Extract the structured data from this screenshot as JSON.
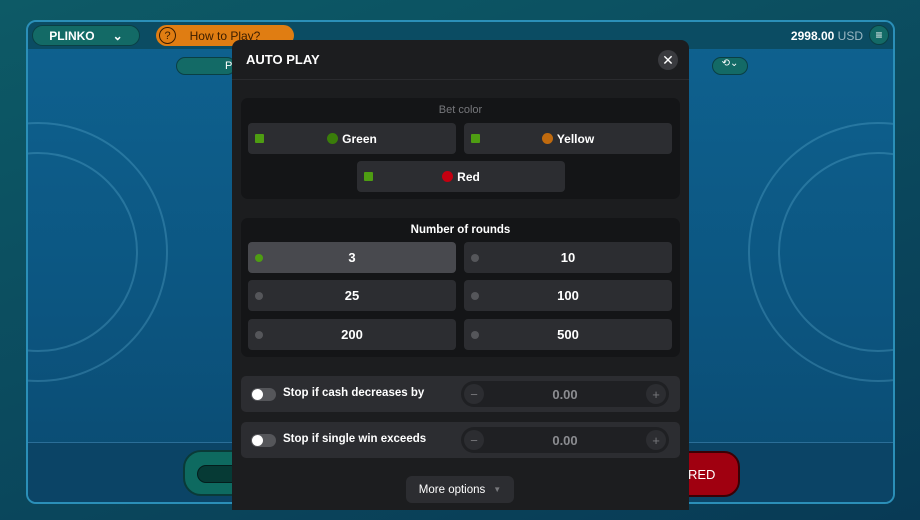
{
  "header": {
    "game": "PLINKO",
    "how_to_play": "How to Play?",
    "balance": "2998.00",
    "currency": "USD",
    "sub_pill": "P"
  },
  "bottom": {
    "red_button": "RED"
  },
  "modal": {
    "title": "AUTO PLAY",
    "bet_color": {
      "title": "Bet color",
      "options": [
        {
          "label": "Green",
          "color": "#3a7d0a",
          "checked": true
        },
        {
          "label": "Yellow",
          "color": "#c06a0e",
          "checked": true
        },
        {
          "label": "Red",
          "color": "#c40010",
          "checked": true
        }
      ]
    },
    "rounds": {
      "title": "Number of rounds",
      "options": [
        "3",
        "10",
        "25",
        "100",
        "200",
        "500"
      ],
      "selected": "3"
    },
    "stop_cash": {
      "label": "Stop if cash decreases by",
      "value": "0.00",
      "enabled": false
    },
    "stop_win": {
      "label": "Stop if single win exceeds",
      "value": "0.00",
      "enabled": false
    },
    "more_options": "More options"
  }
}
